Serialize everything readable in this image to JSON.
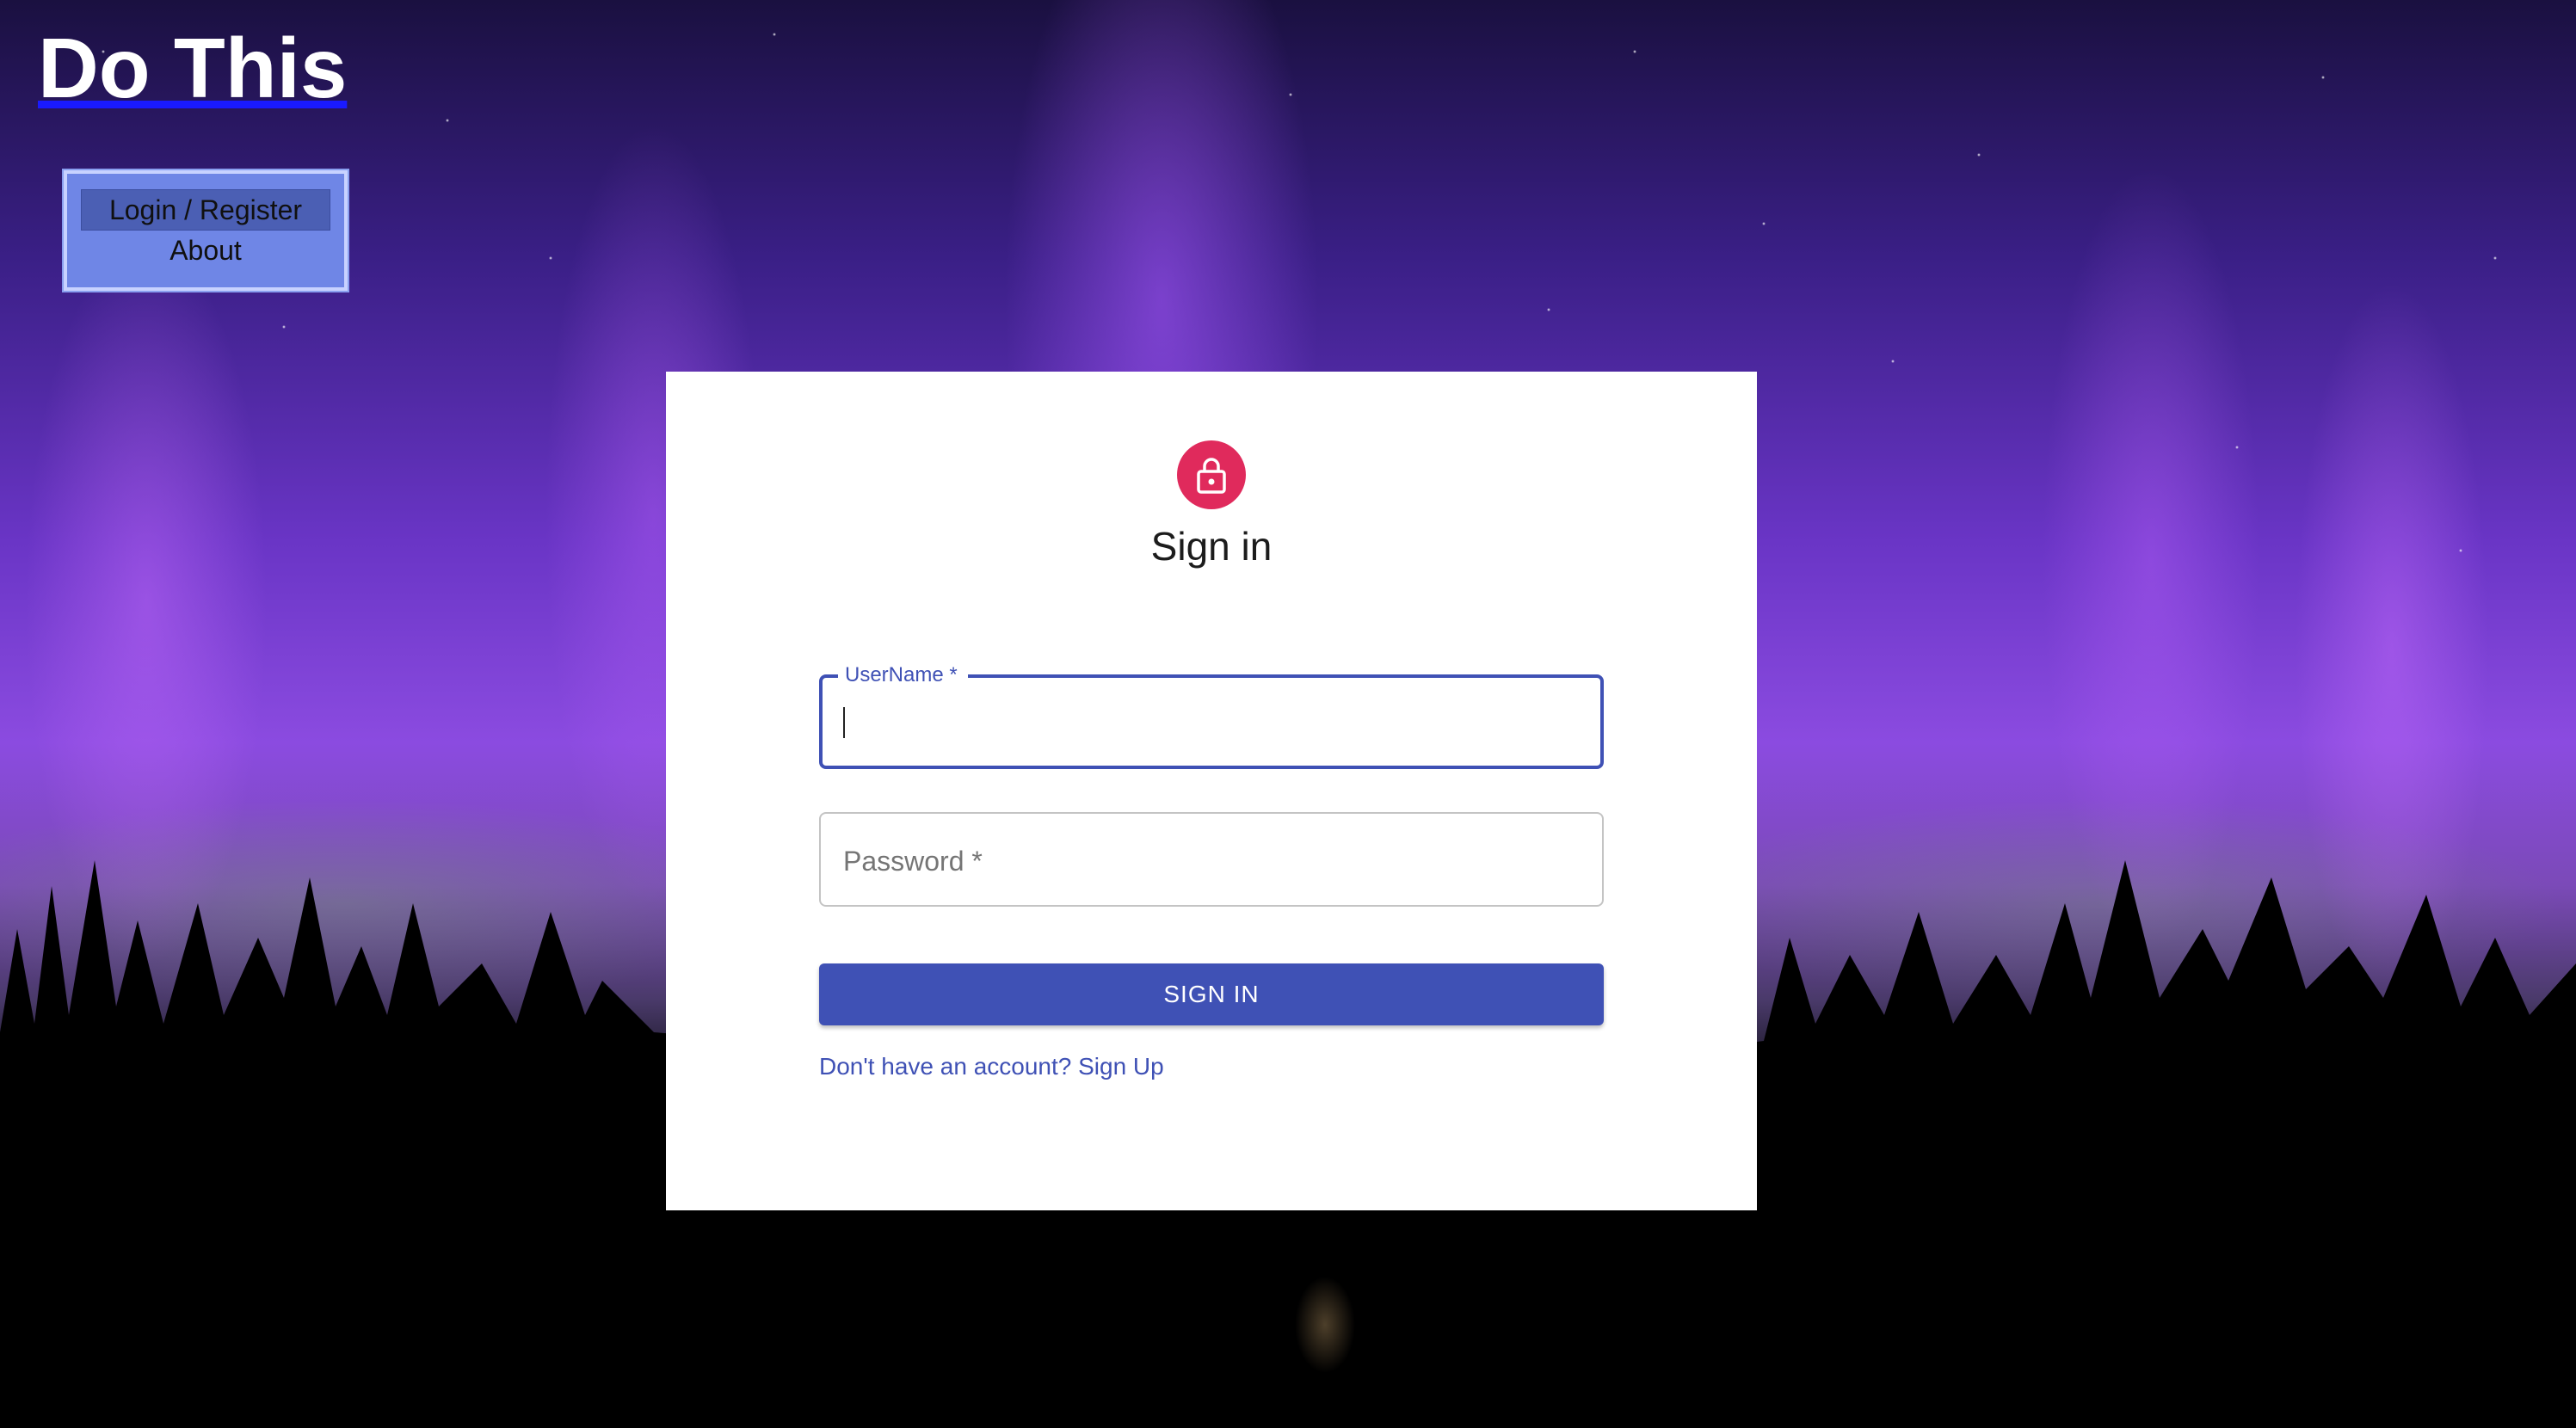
{
  "site": {
    "title": "Do This"
  },
  "nav": {
    "items": [
      {
        "label": "Login / Register",
        "active": true
      },
      {
        "label": "About",
        "active": false
      }
    ]
  },
  "signin": {
    "icon": "lock-icon",
    "title": "Sign in",
    "username": {
      "label": "UserName *",
      "value": ""
    },
    "password": {
      "label": "Password *",
      "value": ""
    },
    "button_label": "SIGN IN",
    "signup_link": "Don't have an account? Sign Up"
  },
  "colors": {
    "primary": "#3f51b5",
    "avatar": "#e02a5c",
    "nav_bg": "#6f86e6",
    "nav_active": "#4b5fb4"
  }
}
